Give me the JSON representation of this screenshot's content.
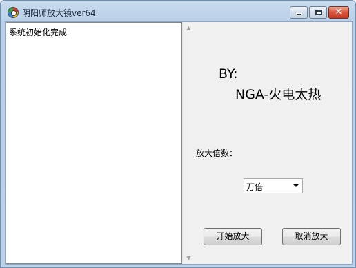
{
  "window": {
    "title": "阴阳师放大镜ver64",
    "icons": {
      "app": "app-icon",
      "minimize": "minimize-icon",
      "maximize": "maximize-icon",
      "close": "close-icon"
    }
  },
  "log": {
    "text": "系统初始化完成"
  },
  "credits": {
    "by": "BY:",
    "author": "NGA-火电太热"
  },
  "zoom": {
    "label": "放大倍数：",
    "selected": "万倍"
  },
  "buttons": {
    "start": "开始放大",
    "cancel": "取消放大"
  },
  "colors": {
    "close_button": "#c43a22",
    "client_background": "#f0f0f0",
    "titlebar": "#bcd2e9"
  }
}
